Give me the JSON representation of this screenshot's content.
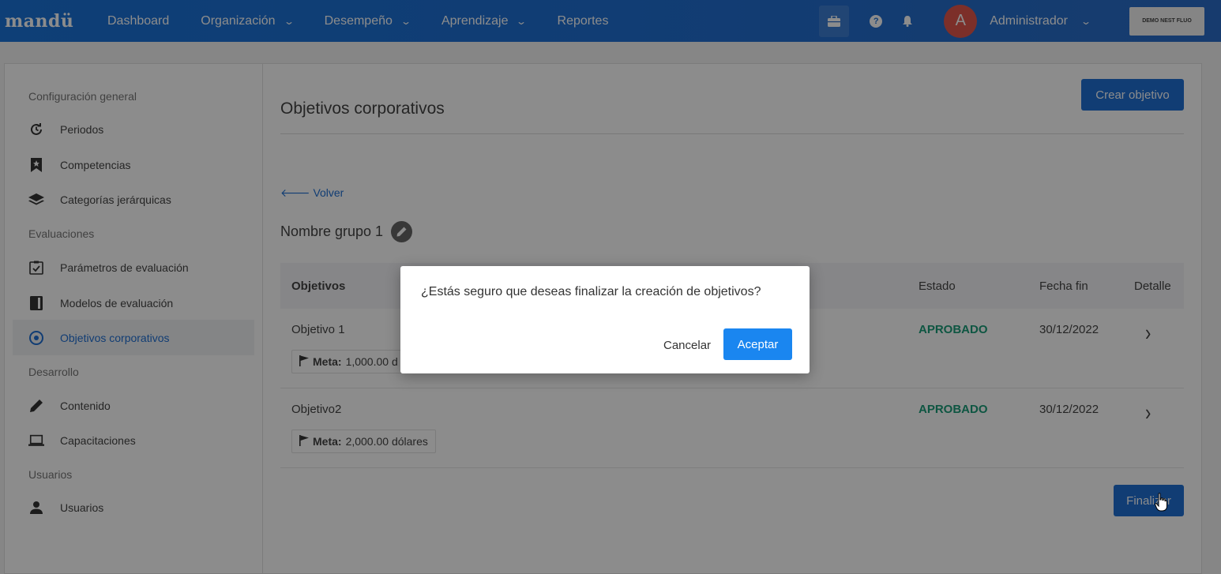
{
  "topbar": {
    "logo": "mandü",
    "nav": [
      {
        "label": "Dashboard",
        "dropdown": false
      },
      {
        "label": "Organización",
        "dropdown": true
      },
      {
        "label": "Desempeño",
        "dropdown": true
      },
      {
        "label": "Aprendizaje",
        "dropdown": true
      },
      {
        "label": "Reportes",
        "dropdown": false
      }
    ],
    "chevron": "⌄",
    "avatar_initial": "A",
    "user_name": "Administrador",
    "company_button": "DEMO NEST FLUO",
    "help_glyph": "?"
  },
  "sidebar": {
    "sections": {
      "general": "Configuración general",
      "evaluaciones": "Evaluaciones",
      "desarrollo": "Desarrollo",
      "usuarios": "Usuarios"
    },
    "items": {
      "periodos": "Periodos",
      "competencias": "Competencias",
      "categorias": "Categorías jerárquicas",
      "parametros": "Parámetros de evaluación",
      "modelos": "Modelos de evaluación",
      "objetivos": "Objetivos corporativos",
      "contenido": "Contenido",
      "capacitaciones": "Capacitaciones",
      "usuarios": "Usuarios"
    }
  },
  "main": {
    "title": "Objetivos corporativos",
    "create_button": "Crear objetivo",
    "back_link": "Volver",
    "group_name": "Nombre grupo 1",
    "table": {
      "headers": {
        "objetivos": "Objetivos",
        "estado": "Estado",
        "fecha_fin": "Fecha fin",
        "detalle": "Detalle"
      },
      "rows": [
        {
          "name": "Objetivo 1",
          "meta_label": "Meta:",
          "meta_value": "1,000.00 d",
          "estado": "APROBADO",
          "fecha_fin": "30/12/2022"
        },
        {
          "name": "Objetivo2",
          "meta_label": "Meta:",
          "meta_value": "2,000.00 dólares",
          "estado": "APROBADO",
          "fecha_fin": "30/12/2022"
        }
      ]
    },
    "finalize_button": "Finalizar"
  },
  "modal": {
    "message": "¿Estás seguro que deseas finalizar la creación de objetivos?",
    "cancel": "Cancelar",
    "accept": "Aceptar"
  },
  "colors": {
    "primary": "#1f6fd3",
    "accent_button": "#1a86f0",
    "approved": "#1a9d78",
    "avatar": "#e2574c"
  }
}
